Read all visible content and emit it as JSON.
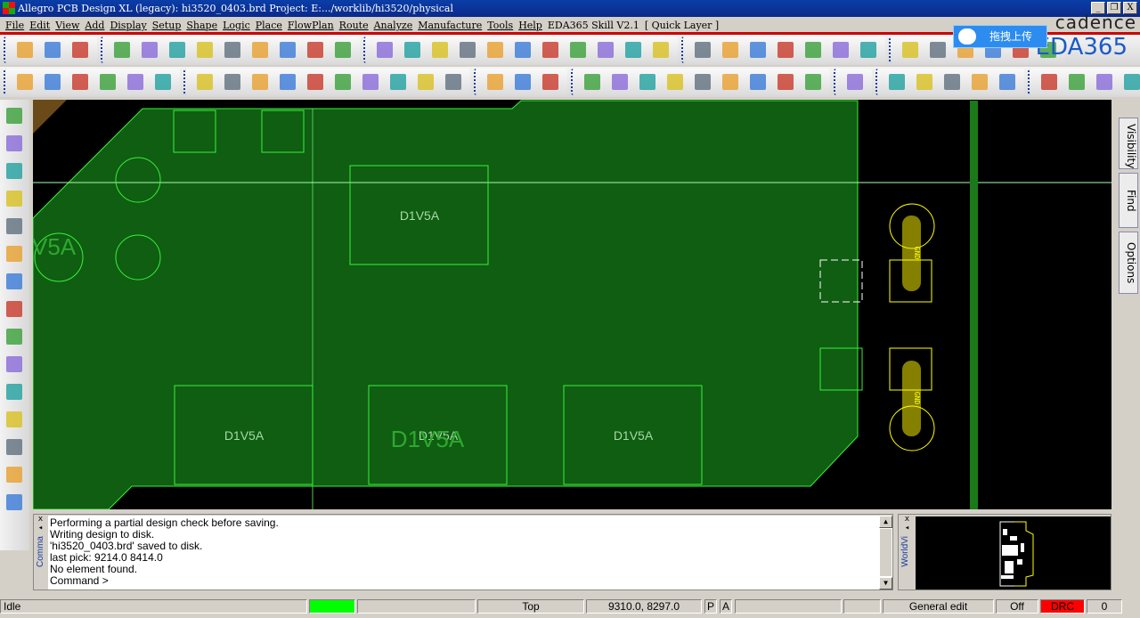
{
  "window": {
    "title": "Allegro PCB Design XL (legacy): hi3520_0403.brd  Project: E:.../worklib/hi3520/physical",
    "minimize": "_",
    "restore": "❐",
    "close": "X"
  },
  "menu": [
    "File",
    "Edit",
    "View",
    "Add",
    "Display",
    "Setup",
    "Shape",
    "Logic",
    "Place",
    "FlowPlan",
    "Route",
    "Analyze",
    "Manufacture",
    "Tools",
    "Help",
    "EDA365 Skill V2.1",
    "[ Quick Layer ]"
  ],
  "branding": {
    "cadence": "cadence",
    "eda365": "EDA365",
    "upload_button": "拖拽上传"
  },
  "toolbar1": [
    [
      "new-file",
      "open-folder",
      "save"
    ],
    [
      "move",
      "copy",
      "delete",
      "undo",
      "down-arrow",
      "redo",
      "down-arrow-2",
      "globe",
      "pin"
    ],
    [
      "zoom-grid",
      "zoom-fit-grid",
      "zoom-points",
      "zoom-fit",
      "zoom-in",
      "zoom-out",
      "zoom-world",
      "zoom-center",
      "refresh",
      "3d-view",
      "flip-view"
    ],
    [
      "grid",
      "color",
      "layers",
      "shape",
      "cm-table",
      "dfa-table",
      "globe-check"
    ],
    [
      "info",
      "measure",
      "ruler-123",
      "bulb",
      "sun",
      "ball"
    ]
  ],
  "toolbar2": [
    [
      "layer-1",
      "layer-2",
      "layer-3",
      "layer-4",
      "layer-5",
      "layer-gray"
    ],
    [
      "step",
      "rect",
      "circle",
      "select-arrow",
      "shape-rect",
      "rotate",
      "square",
      "round-square",
      "slant-square",
      "delete-shape"
    ],
    [
      "component",
      "dimension-vertical",
      "dimension-horizontal"
    ],
    [
      "odb",
      "library",
      "wrench",
      "camera",
      "refdes-renumber",
      "list",
      "chip-grid",
      "testpoint",
      "array"
    ],
    [
      "net-route"
    ],
    [
      "report",
      "book",
      "calendar",
      "checklist",
      "scissors"
    ],
    [
      "window-stack",
      "envelope",
      "mail",
      "help"
    ]
  ],
  "left_toolbar": [
    "place-component",
    "u1-part",
    "resistor",
    "route-connect",
    "slide",
    "delay-tune",
    "fanout",
    "spread",
    "bus",
    "via-array",
    "custom-route",
    "line",
    "rectangle",
    "add-text",
    "edit-text"
  ],
  "right_tabs": [
    "Visibility",
    "Find",
    "Options"
  ],
  "board": {
    "labels": {
      "pad_large": "D1V5A",
      "net_left": "V5A",
      "net_big": "D1V5A",
      "gnd": "GND"
    },
    "colors": {
      "copper": "#0f5e12",
      "outline": "#3af03a",
      "pad": "#ffff00",
      "gnd_fill": "#858000",
      "route": "#1a7a1a"
    }
  },
  "command": {
    "side_label": "Comma",
    "lines": [
      "Performing a partial design check before saving.",
      "Writing design to disk.",
      "'hi3520_0403.brd' saved to disk.",
      "last pick:  9214.0 8414.0",
      "No element found.",
      "Command >"
    ]
  },
  "worldview": {
    "side_label": "WorldVi"
  },
  "status": {
    "state": "Idle",
    "layer": "Top",
    "coords": "9310.0, 8297.0",
    "p": "P",
    "a": "A",
    "mode": "General edit",
    "off": "Off",
    "drc": "DRC",
    "count": "0",
    "ok_color": "#00ff00",
    "drc_color": "#ff0000"
  }
}
